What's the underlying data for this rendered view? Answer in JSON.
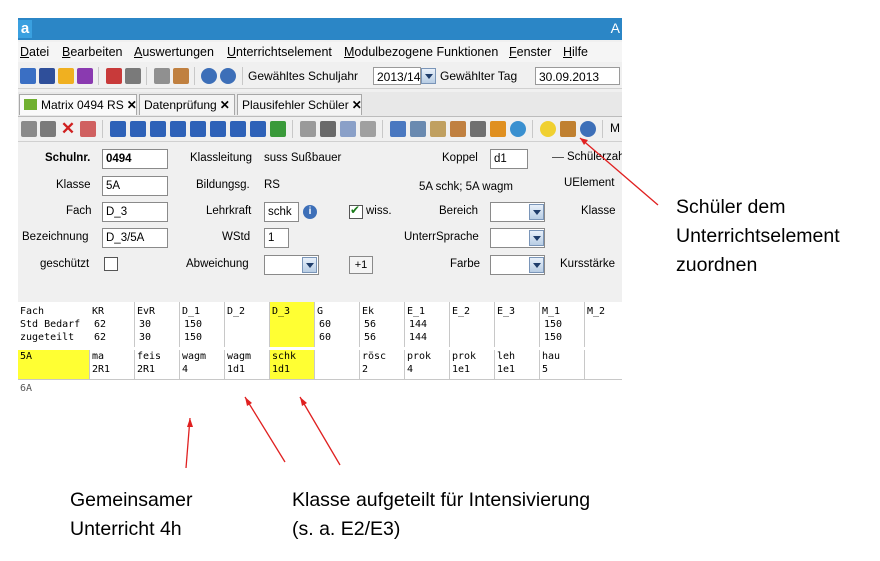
{
  "titlebar": {
    "logo": "a",
    "right_text": "A"
  },
  "menu": [
    "Datei",
    "Bearbeiten",
    "Auswertungen",
    "Unterrichtselement",
    "Modulbezogene Funktionen",
    "Fenster",
    "Hilfe"
  ],
  "toolbar": {
    "schuljahr_label": "Gewähltes Schuljahr",
    "schuljahr_value": "2013/14",
    "tag_label": "Gewählter Tag",
    "tag_value": "30.09.2013"
  },
  "tabs": [
    {
      "label": "Matrix 0494 RS",
      "active": true
    },
    {
      "label": "Datenprüfung",
      "active": false
    },
    {
      "label": "Plausifehler Schüler",
      "active": false
    }
  ],
  "form": {
    "schulnr_label": "Schulnr.",
    "schulnr_value": "0494",
    "klasse_label": "Klasse",
    "klasse_value": "5A",
    "fach_label": "Fach",
    "fach_value": "D_3",
    "bezeichnung_label": "Bezeichnung",
    "bezeichnung_value": "D_3/5A",
    "geschuetzt_label": "geschützt",
    "klassenleitung_label": "Klassleitung",
    "klassenleitung_value": "suss Sußbauer",
    "bildungsg_label": "Bildungsg.",
    "bildungsg_value": "RS",
    "lehrkraft_label": "Lehrkraft",
    "lehrkraft_value": "schk",
    "wiss_label": "wiss.",
    "wstd_label": "WStd",
    "wstd_value": "1",
    "abweichung_label": "Abweichung",
    "plus_label": "+1",
    "koppel_label": "Koppel",
    "koppel_value": "d1",
    "koppel_info": "5A schk; 5A wagm",
    "bereich_label": "Bereich",
    "unterrsprache_label": "UnterrSprache",
    "farbe_label": "Farbe",
    "schuelerzahl_label": "Schülerzah",
    "uelement_label": "UElement",
    "klasse2_label": "Klasse",
    "kursstaerke_label": "Kursstärke"
  },
  "grid": {
    "row_labels": [
      "Fach",
      "Std Bedarf",
      "zugeteilt"
    ],
    "columns": [
      {
        "fach": "KR",
        "bedarf": "62",
        "zugeteilt": "62",
        "cell1": "ma",
        "cell2": "2R1"
      },
      {
        "fach": "EvR",
        "bedarf": "30",
        "zugeteilt": "30",
        "cell1": "feis",
        "cell2": "2R1"
      },
      {
        "fach": "D_1",
        "bedarf": "150",
        "zugeteilt": "150",
        "cell1": "wagm",
        "cell2": "4"
      },
      {
        "fach": "D_2",
        "bedarf": "",
        "zugeteilt": "",
        "cell1": "wagm",
        "cell2": "1d1"
      },
      {
        "fach": "D_3",
        "bedarf": "",
        "zugeteilt": "",
        "cell1": "schk",
        "cell2": "1d1"
      },
      {
        "fach": "G",
        "bedarf": "60",
        "zugeteilt": "60",
        "cell1": "",
        "cell2": ""
      },
      {
        "fach": "Ek",
        "bedarf": "56",
        "zugeteilt": "56",
        "cell1": "rösc",
        "cell2": "2"
      },
      {
        "fach": "E_1",
        "bedarf": "144",
        "zugeteilt": "144",
        "cell1": "prok",
        "cell2": "4"
      },
      {
        "fach": "E_2",
        "bedarf": "",
        "zugeteilt": "",
        "cell1": "prok",
        "cell2": "1e1"
      },
      {
        "fach": "E_3",
        "bedarf": "",
        "zugeteilt": "",
        "cell1": "leh",
        "cell2": "1e1"
      },
      {
        "fach": "M_1",
        "bedarf": "150",
        "zugeteilt": "150",
        "cell1": "hau",
        "cell2": "5"
      },
      {
        "fach": "M_2",
        "bedarf": "",
        "zugeteilt": "",
        "cell1": "",
        "cell2": ""
      }
    ],
    "class_row_label": "5A",
    "next_row_label": "6A"
  },
  "annotations": {
    "top_right_line1": "Schüler dem",
    "top_right_line2": "Unterrichtselement",
    "top_right_line3": "zuordnen",
    "bottom_left_line1": "Gemeinsamer",
    "bottom_left_line2": "Unterricht 4h",
    "bottom_mid_line1": "Klasse aufgeteilt für Intensivierung",
    "bottom_mid_line2": "(s. a. E2/E3)"
  },
  "colors": {
    "highlight": "#ffff33",
    "titlebar": "#2b86c6",
    "arrow": "#e02020"
  }
}
